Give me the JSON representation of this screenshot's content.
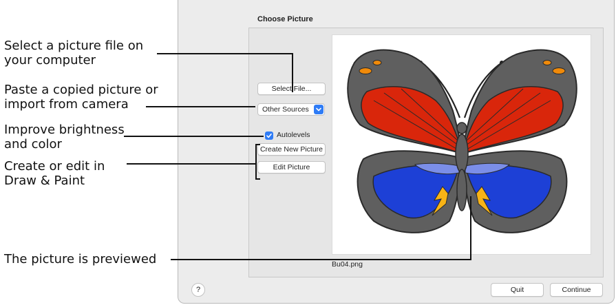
{
  "callouts": {
    "select_file_line1": "Select a picture file on",
    "select_file_line2": "your computer",
    "paste_line1": "Paste a copied picture or",
    "paste_line2": "import from camera",
    "brightness_line1": "Improve brightness",
    "brightness_line2": "and color",
    "draw_line1": "Create or edit in",
    "draw_line2": "Draw & Paint",
    "preview_note": "The picture is previewed"
  },
  "dialog": {
    "panel_title": "Choose Picture",
    "select_file_label": "Select File...",
    "other_sources_value": "Other Sources",
    "autolevels_label": "Autolevels",
    "autolevels_checked": true,
    "create_new_label": "Create New Picture",
    "edit_picture_label": "Edit Picture",
    "filename": "Bu04.png",
    "help_label": "?",
    "quit_label": "Quit",
    "continue_label": "Continue"
  },
  "colors": {
    "accent": "#2f7cf6",
    "wing_red": "#d9260b",
    "wing_blue": "#1d40d6",
    "wing_gray": "#5f5f5f",
    "spot_orange": "#f08a0a",
    "spot_yellow": "#f7b316"
  },
  "icons": {
    "checkbox": "checkmark-icon",
    "dropdown": "chevron-down-icon",
    "preview": "butterfly-image"
  }
}
